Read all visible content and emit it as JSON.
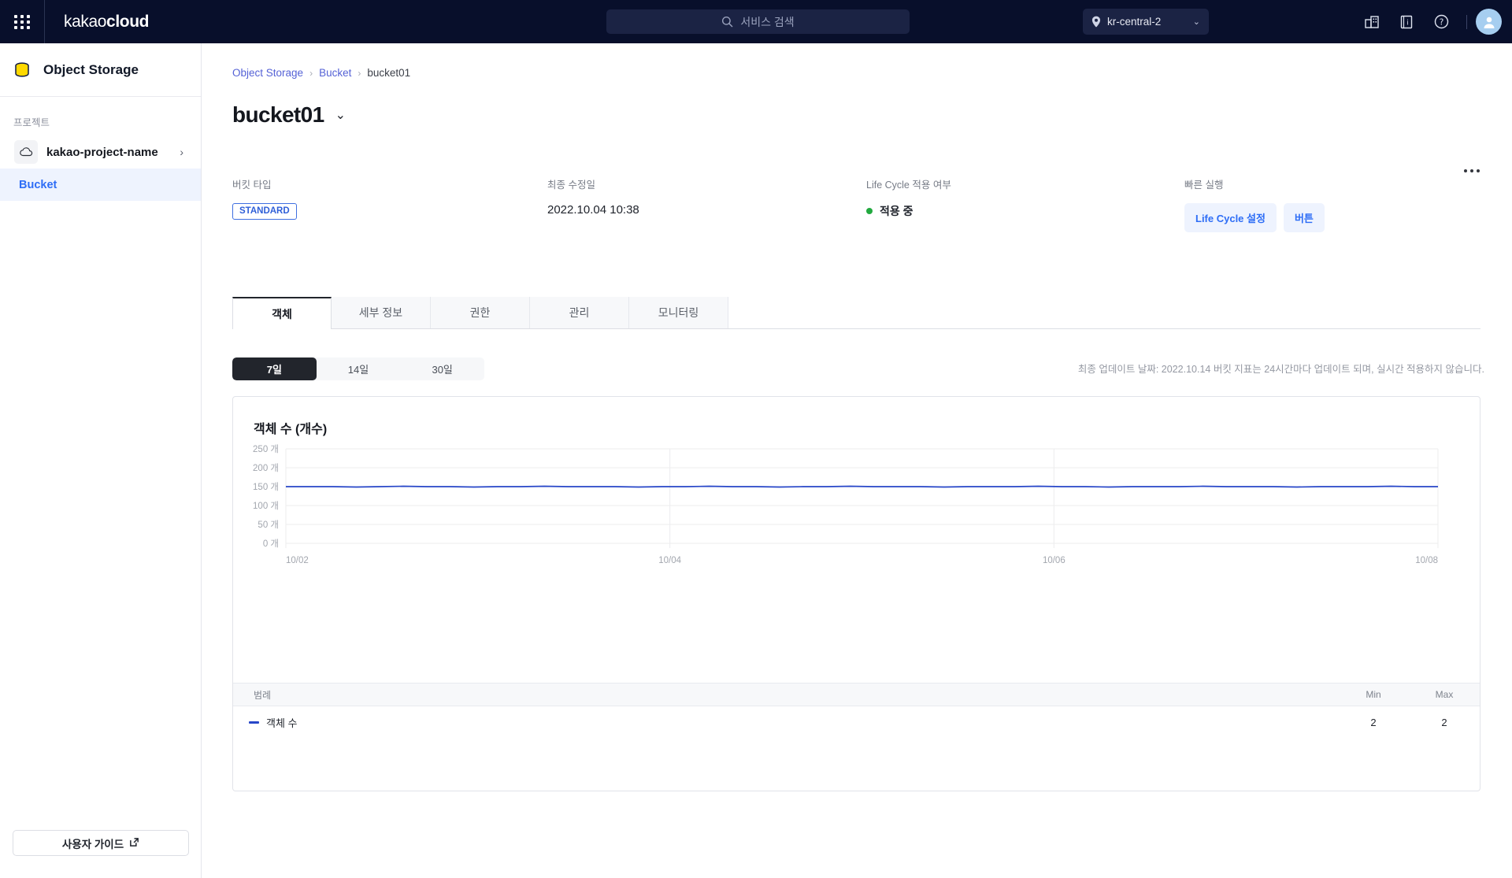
{
  "topbar": {
    "apps_icon": "grid-apps-icon",
    "brand_light": "kakao",
    "brand_bold": "cloud",
    "search": {
      "placeholder": "서비스 검색",
      "icon": "search-icon"
    },
    "region": {
      "label": "kr-central-2",
      "icon": "location-pin-icon",
      "chevron": "⌄"
    },
    "icons": [
      "organization-icon",
      "docs-icon",
      "help-icon"
    ],
    "avatar": "user-avatar-icon"
  },
  "sidebar": {
    "service_name": "Object Storage",
    "service_icon": "database-stack-icon",
    "project_label": "프로젝트",
    "project": {
      "name": "kakao-project-name",
      "icon": "cloud-icon",
      "chevron": "›"
    },
    "nav": [
      {
        "label": "Bucket",
        "active": true
      }
    ],
    "guide_button": {
      "label": "사용자 가이드",
      "icon": "external-link-icon"
    }
  },
  "main": {
    "breadcrumb": [
      {
        "label": "Object Storage",
        "link": true
      },
      {
        "label": "Bucket",
        "link": true
      },
      {
        "label": "bucket01",
        "link": false
      }
    ],
    "breadcrumb_sep": "›",
    "page_title": "bucket01",
    "title_chevron": "⌄",
    "more_menu": "more-options-icon",
    "info": {
      "bucket_type": {
        "label": "버킷 타입",
        "value": "STANDARD"
      },
      "last_modified": {
        "label": "최종 수정일",
        "value": "2022.10.04 10:38"
      },
      "lifecycle": {
        "label": "Life Cycle 적용 여부",
        "value": "적용 중",
        "status_color": "#22a93f"
      },
      "quick_actions": {
        "label": "빠른 실행",
        "buttons": [
          "Life Cycle 설정",
          "버튼"
        ]
      }
    },
    "tabs": [
      {
        "label": "객체",
        "active": true
      },
      {
        "label": "세부 정보",
        "active": false
      },
      {
        "label": "권한",
        "active": false
      },
      {
        "label": "관리",
        "active": false
      },
      {
        "label": "모니터링",
        "active": false
      }
    ],
    "period_buttons": [
      {
        "label": "7일",
        "active": true
      },
      {
        "label": "14일",
        "active": false
      },
      {
        "label": "30일",
        "active": false
      }
    ],
    "update_note": "최종 업데이트 날짜: 2022.10.14   버킷 지표는 24시간마다 업데이트 되며, 실시간 적용하지 않습니다.",
    "legend_table": {
      "headers": {
        "name": "범례",
        "min": "Min",
        "max": "Max"
      },
      "rows": [
        {
          "name": "객체 수",
          "min": "2",
          "max": "2",
          "color": "#2746c8"
        }
      ]
    }
  },
  "chart_data": {
    "type": "line",
    "title": "객체 수 (개수)",
    "xlabel": "",
    "ylabel": "",
    "grid": true,
    "legend_position": "bottom-table",
    "ylim": [
      0,
      250
    ],
    "yticks": [
      0,
      50,
      100,
      150,
      200,
      250
    ],
    "ytick_labels": [
      "0 개",
      "50 개",
      "100 개",
      "150 개",
      "200 개",
      "250 개"
    ],
    "xticks": [
      "10/02",
      "10/04",
      "10/06",
      "10/08"
    ],
    "series": [
      {
        "name": "객체 수",
        "color": "#2746c8",
        "values": [
          150,
          150,
          150,
          149,
          150,
          151,
          150,
          150,
          149,
          150,
          150,
          151,
          150,
          150,
          150,
          149,
          150,
          150,
          151,
          150,
          150,
          149,
          150,
          150,
          151,
          150,
          150,
          150,
          149,
          150,
          150,
          150,
          151,
          150,
          150,
          149,
          150,
          150,
          150,
          151,
          150,
          150,
          150,
          149,
          150,
          150,
          150,
          151,
          150,
          150
        ]
      }
    ]
  }
}
